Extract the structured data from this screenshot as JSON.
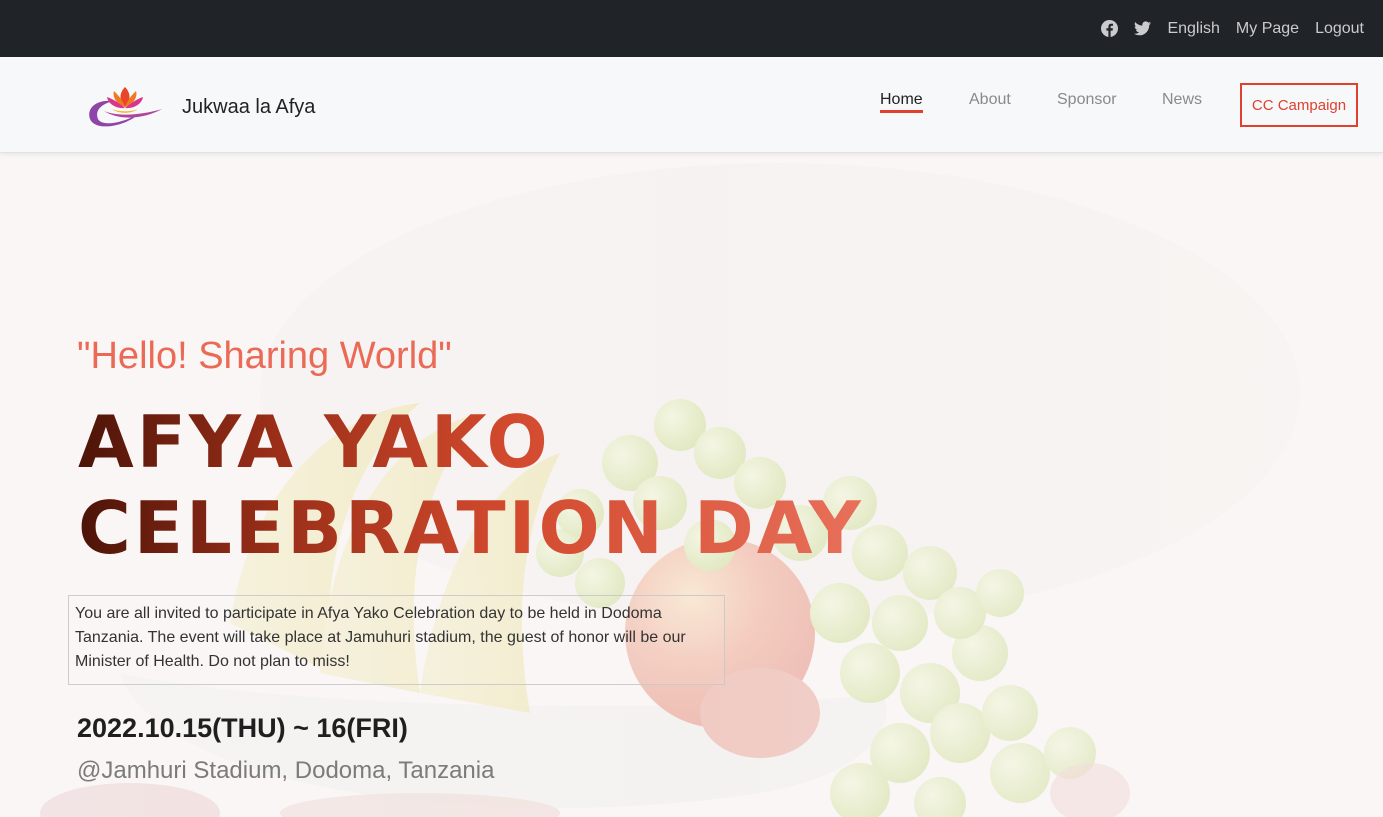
{
  "topbar": {
    "icons": [
      "facebook-icon",
      "twitter-icon"
    ],
    "language": "English",
    "my_page": "My Page",
    "logout": "Logout"
  },
  "header": {
    "brand_name": "Jukwaa la Afya",
    "nav": [
      {
        "label": "Home",
        "active": true
      },
      {
        "label": "About",
        "active": false
      },
      {
        "label": "Sponsor",
        "active": false
      },
      {
        "label": "News",
        "active": false
      }
    ],
    "cta_label": "CC Campaign"
  },
  "hero": {
    "tagline": "\"Hello! Sharing World\"",
    "title_line1": "AFYA YAKO",
    "title_line2": "CELEBRATION DAY",
    "description": "You are all invited to participate in Afya Yako Celebration day to be held in Dodoma Tanzania. The event will take place at Jamuhuri stadium, the guest of honor will be our Minister of Health. Do not plan to miss!",
    "date": "2022.10.15(THU) ~ 16(FRI)",
    "venue": "@Jamhuri Stadium, Dodoma, Tanzania"
  },
  "colors": {
    "accent": "#e0402e",
    "topbar_bg": "#202327",
    "tagline": "#ea6a56"
  }
}
